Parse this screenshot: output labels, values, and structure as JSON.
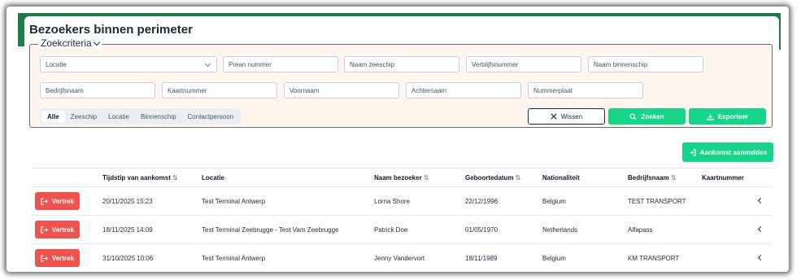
{
  "page": {
    "title": "Bezoekers binnen perimeter"
  },
  "criteria": {
    "legend": "Zoekcriteria",
    "fields": {
      "locatie": "Locatie",
      "prean": "Prean nummer",
      "zeeschip": "Naam zeeschip",
      "verblijf": "Verblijfsnummer",
      "binnenschip": "Naam binnenschip",
      "bedrijf": "Bedrijfsnaam",
      "kaart": "Kaartnummer",
      "voornaam": "Voornaam",
      "achternaam": "Achternaam",
      "nummerplaat": "Nummerplaat"
    },
    "tabs": [
      "Alle",
      "Zeeschip",
      "Locatie",
      "Binnenschip",
      "Contactpersoon"
    ],
    "active_tab": "Alle",
    "wissen": "Wissen",
    "zoeken": "Zoeken",
    "exporteer": "Exporteer"
  },
  "actions": {
    "aankomst": "Aankomst aanmelden"
  },
  "table": {
    "headers": {
      "tijdstip": "Tijdstip van aankomst",
      "locatie": "Locatie",
      "naam": "Naam bezoeker",
      "geboorte": "Geboortedatum",
      "nationaliteit": "Nationaliteit",
      "bedrijf": "Bedrijfsnaam",
      "kaart": "Kaartnummer"
    },
    "vertrek_label": "Vertrek",
    "rows": [
      {
        "tijdstip": "20/11/2025 15:23",
        "locatie": "Test Terminal Antwerp",
        "naam": "Lorna Shore",
        "geboorte": "22/12/1996",
        "nationaliteit": "Belgium",
        "bedrijf": "TEST TRANSPORT",
        "kaart": ""
      },
      {
        "tijdstip": "18/11/2025 14:09",
        "locatie": "Test Terminal Zeebrugge - Test Vam Zeebrugge",
        "naam": "Patrick Doe",
        "geboorte": "01/05/1970",
        "nationaliteit": "Netherlands",
        "bedrijf": "Alfapass",
        "kaart": ""
      },
      {
        "tijdstip": "31/10/2025 10:06",
        "locatie": "Test Terminal Antwerp",
        "naam": "Jenny Vandervort",
        "geboorte": "18/11/1989",
        "nationaliteit": "Belgium",
        "bedrijf": "KM TRANSPORT",
        "kaart": ""
      }
    ]
  },
  "colors": {
    "green": "#17d48b",
    "red": "#ef5350",
    "brand_dark": "#1f7a4a"
  }
}
